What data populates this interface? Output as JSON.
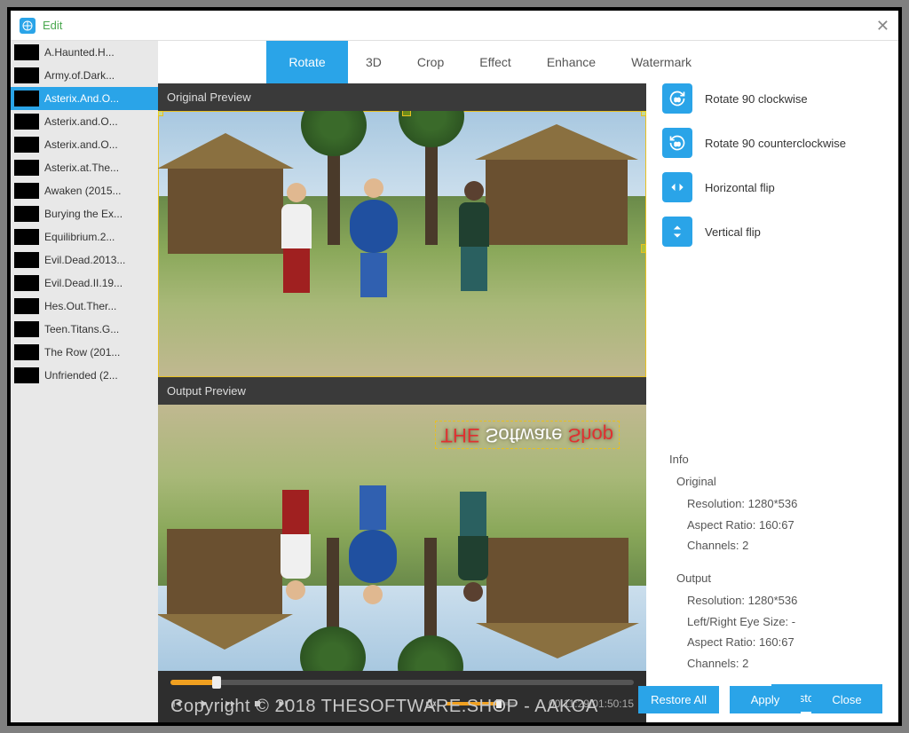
{
  "window": {
    "title": "Edit"
  },
  "sidebar": {
    "items": [
      {
        "label": "A.Haunted.H..."
      },
      {
        "label": "Army.of.Dark..."
      },
      {
        "label": "Asterix.And.O..."
      },
      {
        "label": "Asterix.and.O..."
      },
      {
        "label": "Asterix.and.O..."
      },
      {
        "label": "Asterix.at.The..."
      },
      {
        "label": "Awaken (2015..."
      },
      {
        "label": "Burying the Ex..."
      },
      {
        "label": "Equilibrium.2..."
      },
      {
        "label": "Evil.Dead.2013..."
      },
      {
        "label": "Evil.Dead.II.19..."
      },
      {
        "label": "Hes.Out.Ther..."
      },
      {
        "label": "Teen.Titans.G..."
      },
      {
        "label": "The Row (201..."
      },
      {
        "label": "Unfriended (2..."
      }
    ],
    "selected_index": 2
  },
  "tabs": {
    "items": [
      "Rotate",
      "3D",
      "Crop",
      "Effect",
      "Enhance",
      "Watermark"
    ],
    "active_index": 0
  },
  "preview": {
    "original_label": "Original Preview",
    "output_label": "Output Preview",
    "watermark_text_a": "THE",
    "watermark_text_b": "Software",
    "watermark_text_c": "Shop"
  },
  "player": {
    "current": "00:11:29",
    "total": "01:50:15"
  },
  "actions": {
    "rotate_cw": "Rotate 90 clockwise",
    "rotate_ccw": "Rotate 90 counterclockwise",
    "hflip": "Horizontal flip",
    "vflip": "Vertical flip"
  },
  "info": {
    "title": "Info",
    "original": {
      "heading": "Original",
      "resolution_label": "Resolution:",
      "resolution": "1280*536",
      "aspect_label": "Aspect Ratio:",
      "aspect": "160:67",
      "channels_label": "Channels:",
      "channels": "2"
    },
    "output": {
      "heading": "Output",
      "resolution_label": "Resolution:",
      "resolution": "1280*536",
      "eye_label": "Left/Right Eye Size:",
      "eye": "-",
      "aspect_label": "Aspect Ratio:",
      "aspect": "160:67",
      "channels_label": "Channels:",
      "channels": "2"
    }
  },
  "buttons": {
    "restore_defaults": "Restore Defaults",
    "restore_all": "Restore All",
    "apply": "Apply",
    "close": "Close"
  },
  "copyright": "Copyright © 2018  THESOFTWARE.SHOP - AAKOA"
}
